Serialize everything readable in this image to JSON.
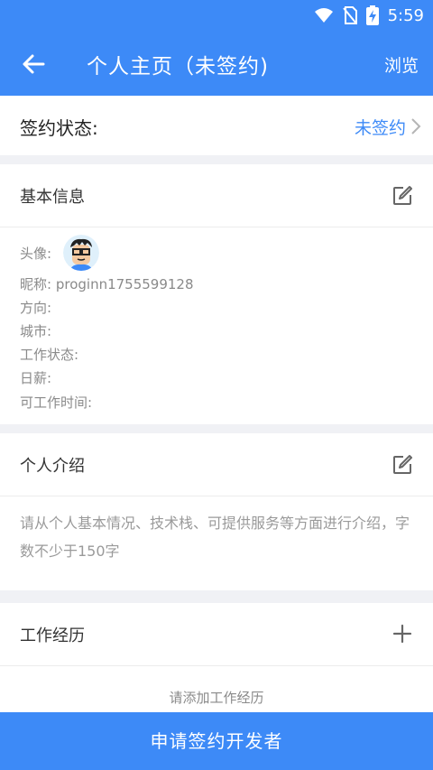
{
  "status_bar": {
    "time": "5:59",
    "icons": [
      "wifi-icon",
      "no-sim-icon",
      "battery-charging-icon"
    ]
  },
  "app_bar": {
    "back_icon": "arrow-left-icon",
    "title": "个人主页（未签约)",
    "browse_label": "浏览"
  },
  "sign_status": {
    "label": "签约状态:",
    "value": "未签约"
  },
  "basic_info": {
    "title": "基本信息",
    "avatar_label": "头像:",
    "nickname_label": "昵称:",
    "nickname_value": "proginn1755599128",
    "direction_label": "方向:",
    "city_label": "城市:",
    "work_status_label": "工作状态:",
    "daily_pay_label": "日薪:",
    "available_time_label": "可工作时间:"
  },
  "intro": {
    "title": "个人介绍",
    "placeholder": "请从个人基本情况、技术栈、可提供服务等方面进行介绍，字数不少于150字"
  },
  "work_history": {
    "title": "工作经历",
    "empty_text": "请添加工作经历"
  },
  "bottom_button": {
    "label": "申请签约开发者"
  },
  "colors": {
    "primary": "#3d8af7",
    "background": "#f0f1f5",
    "text": "#333333",
    "muted": "#8a8a8a"
  }
}
